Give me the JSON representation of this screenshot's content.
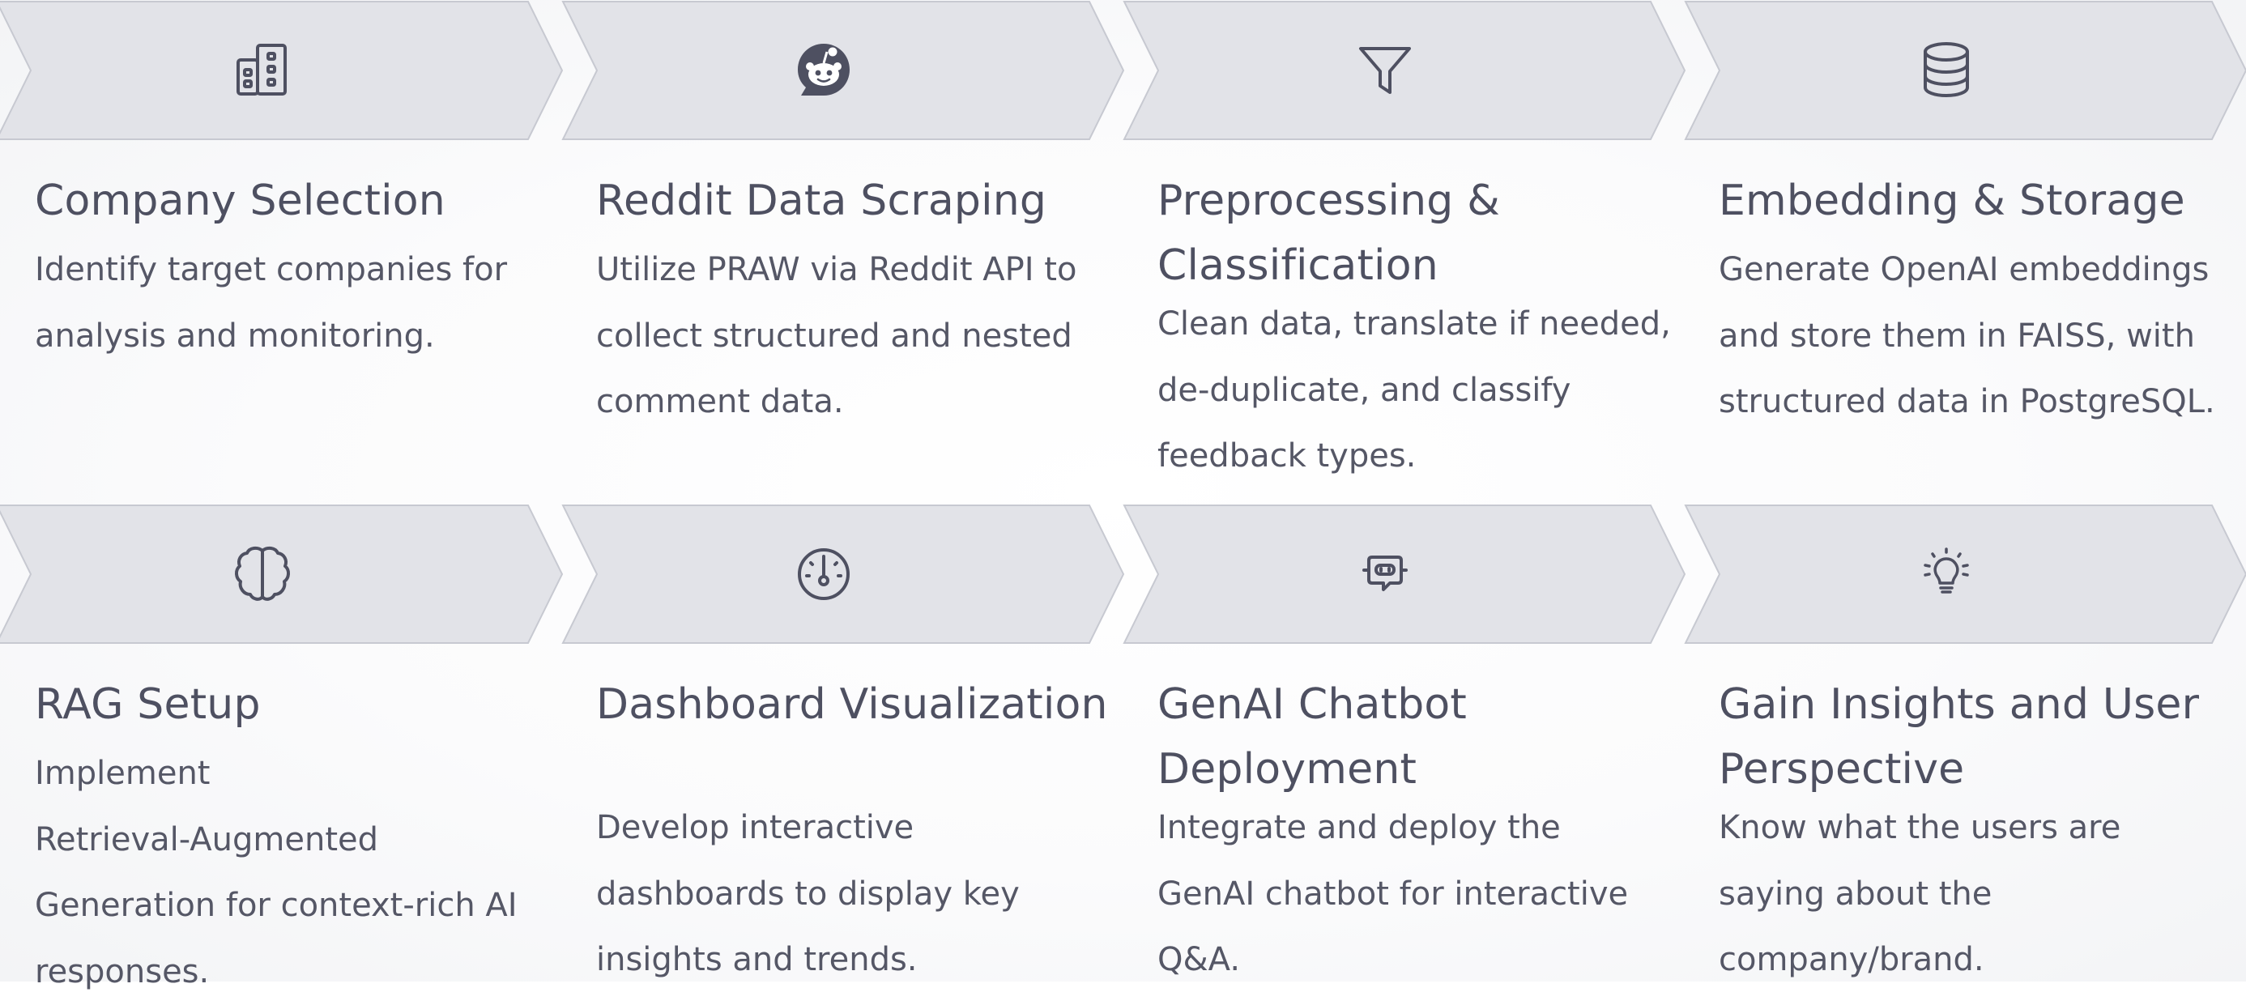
{
  "colors": {
    "chevron_fill": "#e2e3e8",
    "chevron_stroke": "#c7c9d1",
    "icon": "#4e5061",
    "title": "#4e5061",
    "text": "#555766"
  },
  "steps": [
    {
      "icon": "building-icon",
      "title_lines": [
        "Company Selection"
      ],
      "description_lines": [
        "Identify target companies for",
        "analysis and monitoring."
      ]
    },
    {
      "icon": "reddit-icon",
      "title_lines": [
        "Reddit Data Scraping"
      ],
      "description_lines": [
        "Utilize PRAW via Reddit API to",
        "collect structured and nested",
        "comment data."
      ]
    },
    {
      "icon": "filter-icon",
      "title_lines": [
        "Preprocessing &",
        "Classification"
      ],
      "description_lines": [
        "Clean data, translate if needed,",
        "de-duplicate, and classify",
        "feedback types."
      ]
    },
    {
      "icon": "database-icon",
      "title_lines": [
        "Embedding & Storage"
      ],
      "description_lines": [
        "Generate OpenAI embeddings",
        "and store them in FAISS, with",
        "structured data in PostgreSQL."
      ]
    },
    {
      "icon": "brain-icon",
      "title_lines": [
        "RAG Setup"
      ],
      "description_lines": [
        "Implement",
        "Retrieval-Augmented",
        "Generation for context-rich AI",
        "responses."
      ]
    },
    {
      "icon": "gauge-icon",
      "title_lines": [
        "Dashboard Visualization"
      ],
      "description_lines": [
        "Develop interactive",
        "dashboards to display key",
        "insights and trends."
      ]
    },
    {
      "icon": "chatbot-icon",
      "title_lines": [
        "GenAI Chatbot",
        "Deployment"
      ],
      "description_lines": [
        "Integrate and deploy the",
        "GenAI chatbot for interactive",
        "Q&A."
      ]
    },
    {
      "icon": "lightbulb-icon",
      "title_lines": [
        "Gain Insights and User",
        "Perspective"
      ],
      "description_lines": [
        "Know what the users are",
        "saying about the",
        "company/brand."
      ]
    }
  ]
}
